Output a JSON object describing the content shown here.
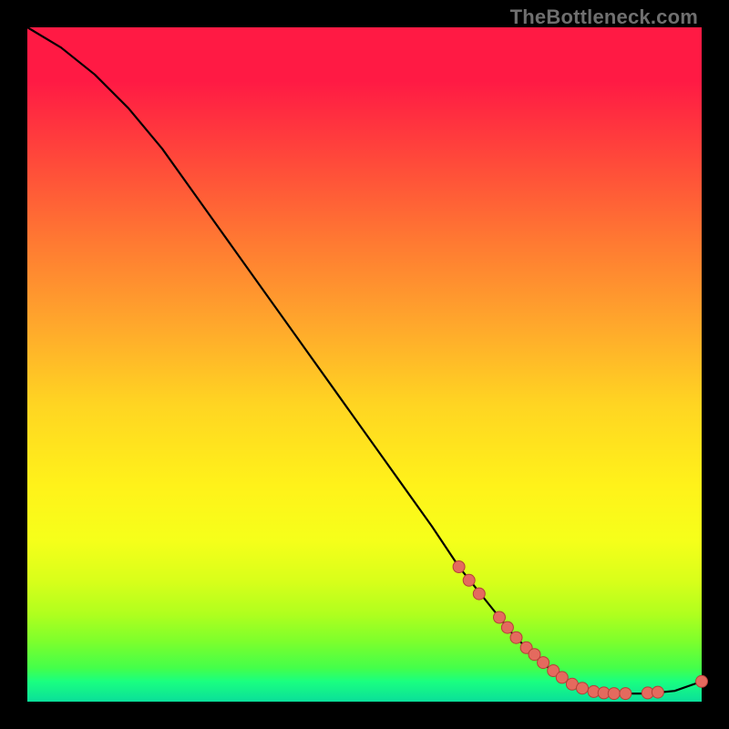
{
  "watermark": "TheBottleneck.com",
  "colors": {
    "dot_fill": "#e46a5e",
    "dot_stroke": "#b53f38",
    "curve_stroke": "#000000",
    "frame_bg": "#000000"
  },
  "chart_data": {
    "type": "line",
    "title": "",
    "xlabel": "",
    "ylabel": "",
    "xlim": [
      0,
      100
    ],
    "ylim": [
      0,
      100
    ],
    "series": [
      {
        "name": "bottleneck-curve",
        "x": [
          0,
          5,
          10,
          15,
          20,
          25,
          30,
          35,
          40,
          45,
          50,
          55,
          60,
          64,
          68,
          72,
          76,
          80,
          84,
          88,
          92,
          96,
          100
        ],
        "y": [
          100,
          97,
          93,
          88,
          82,
          75,
          68,
          61,
          54,
          47,
          40,
          33,
          26,
          20,
          15,
          10,
          6,
          3,
          1.5,
          1.2,
          1.2,
          1.6,
          3
        ]
      }
    ],
    "scatter": [
      {
        "name": "highlighted-points",
        "points": [
          {
            "x": 64,
            "y": 20
          },
          {
            "x": 65.5,
            "y": 18
          },
          {
            "x": 67,
            "y": 16
          },
          {
            "x": 70,
            "y": 12.5
          },
          {
            "x": 71.2,
            "y": 11
          },
          {
            "x": 72.5,
            "y": 9.5
          },
          {
            "x": 74,
            "y": 8
          },
          {
            "x": 75.2,
            "y": 7
          },
          {
            "x": 76.5,
            "y": 5.8
          },
          {
            "x": 78,
            "y": 4.6
          },
          {
            "x": 79.3,
            "y": 3.6
          },
          {
            "x": 80.8,
            "y": 2.6
          },
          {
            "x": 82.3,
            "y": 2
          },
          {
            "x": 84,
            "y": 1.5
          },
          {
            "x": 85.5,
            "y": 1.3
          },
          {
            "x": 87,
            "y": 1.2
          },
          {
            "x": 88.7,
            "y": 1.2
          },
          {
            "x": 92,
            "y": 1.3
          },
          {
            "x": 93.5,
            "y": 1.4
          },
          {
            "x": 100,
            "y": 3
          }
        ]
      }
    ]
  }
}
